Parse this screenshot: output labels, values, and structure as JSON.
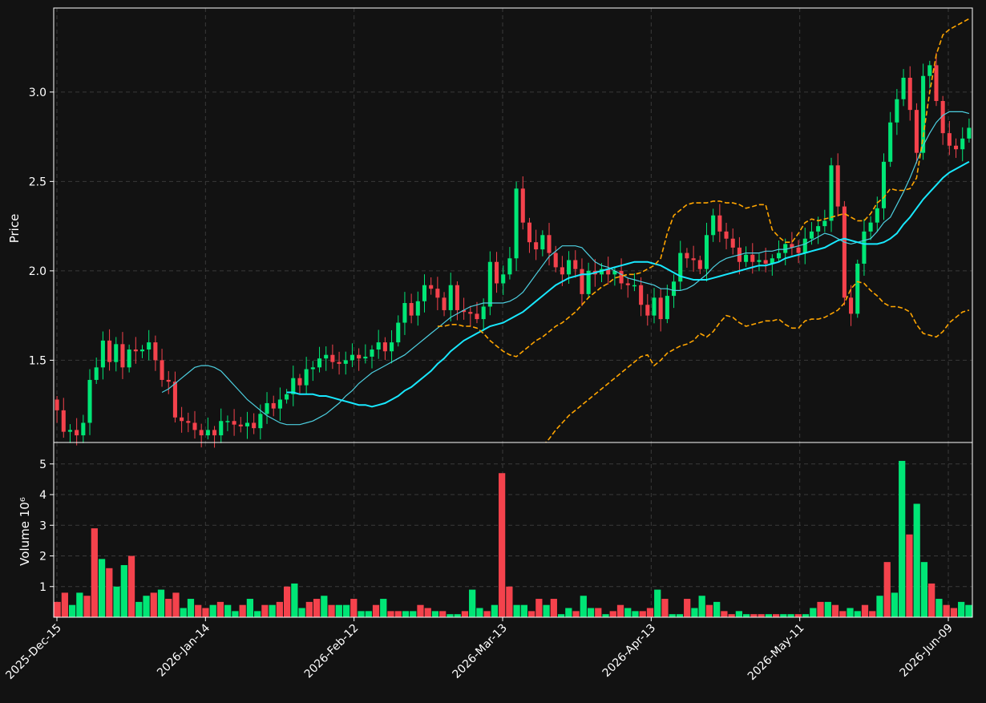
{
  "colors": {
    "background": "#121212",
    "axis": "#ffffff",
    "grid": "#3a3a3a",
    "up": "#00e676",
    "down": "#f4424c",
    "ma_fast": "#4dd0e1",
    "ma_slow": "#18e8ff",
    "bollinger": "#ffa500"
  },
  "chart_data": [
    {
      "type": "candlestick",
      "panel": "price",
      "ylabel": "Price",
      "ylim": [
        1.04,
        3.47
      ],
      "yticks": [
        "1.5",
        "2.0",
        "2.5",
        "3.0"
      ],
      "grid": true,
      "x_tick_labels": [
        "2025-Dec-15",
        "2026-Jan-14",
        "2026-Feb-12",
        "2026-Mar-13",
        "2026-Apr-13",
        "2026-May-11",
        "2026-Jun-09"
      ],
      "x_tick_positions": [
        0,
        26,
        52,
        78,
        104,
        130,
        156
      ],
      "series": [
        {
          "kind": "ohlc",
          "close": [
            1.22,
            1.1,
            1.11,
            1.08,
            1.15,
            1.39,
            1.46,
            1.61,
            1.49,
            1.59,
            1.46,
            1.56,
            1.55,
            1.56,
            1.6,
            1.5,
            1.39,
            1.38,
            1.18,
            1.16,
            1.15,
            1.11,
            1.08,
            1.11,
            1.08,
            1.16,
            1.16,
            1.14,
            1.13,
            1.15,
            1.12,
            1.2,
            1.26,
            1.23,
            1.28,
            1.31,
            1.4,
            1.36,
            1.45,
            1.46,
            1.51,
            1.53,
            1.49,
            1.48,
            1.5,
            1.53,
            1.51,
            1.52,
            1.56,
            1.6,
            1.55,
            1.6,
            1.71,
            1.82,
            1.75,
            1.83,
            1.92,
            1.9,
            1.85,
            1.78,
            1.92,
            1.78,
            1.77,
            1.76,
            1.73,
            1.8,
            2.05,
            1.93,
            1.98,
            2.07,
            2.46,
            2.27,
            2.16,
            2.12,
            2.2,
            2.1,
            2.02,
            1.98,
            2.06,
            2.01,
            1.87,
            2.0,
            1.98,
            2.01,
            1.98,
            2.0,
            1.93,
            1.92,
            1.92,
            1.81,
            1.75,
            1.85,
            1.73,
            1.86,
            1.94,
            2.1,
            2.07,
            2.06,
            2.01,
            2.2,
            2.31,
            2.22,
            2.18,
            2.13,
            2.05,
            2.09,
            2.05,
            2.06,
            2.04,
            2.07,
            2.1,
            2.15,
            2.13,
            2.1,
            2.18,
            2.22,
            2.25,
            2.28,
            2.59,
            2.36,
            1.85,
            1.76,
            2.04,
            2.22,
            2.27,
            2.35,
            2.61,
            2.83,
            2.96,
            3.08,
            2.9,
            2.66,
            3.09,
            3.15,
            2.95,
            2.77,
            2.7,
            2.68,
            2.74,
            2.8
          ]
        },
        {
          "kind": "moving_average",
          "name": "",
          "values": [
            1.32,
            1.34,
            1.37,
            1.4,
            1.43,
            1.46,
            1.47,
            1.47,
            1.46,
            1.44,
            1.4,
            1.36,
            1.32,
            1.28,
            1.25,
            1.22,
            1.19,
            1.17,
            1.15,
            1.14,
            1.14,
            1.14,
            1.15,
            1.16,
            1.18,
            1.2,
            1.23,
            1.26,
            1.3,
            1.33,
            1.37,
            1.4,
            1.43,
            1.45,
            1.47,
            1.49,
            1.51,
            1.53,
            1.56,
            1.59,
            1.62,
            1.65,
            1.68,
            1.71,
            1.74,
            1.76,
            1.78,
            1.8,
            1.81,
            1.82,
            1.82,
            1.82,
            1.82,
            1.83,
            1.85,
            1.88,
            1.93,
            1.98,
            2.03,
            2.08,
            2.11,
            2.14,
            2.14,
            2.14,
            2.13,
            2.09,
            2.05,
            2.03,
            2.02,
            2.0,
            1.98,
            1.96,
            1.95,
            1.94,
            1.93,
            1.92,
            1.9,
            1.9,
            1.89,
            1.89,
            1.9,
            1.92,
            1.95,
            1.98,
            2.02,
            2.05,
            2.07,
            2.08,
            2.09,
            2.1,
            2.1,
            2.1,
            2.11,
            2.11,
            2.12,
            2.12,
            2.13,
            2.14,
            2.15,
            2.17,
            2.19,
            2.21,
            2.2,
            2.18,
            2.16,
            2.15,
            2.16,
            2.17,
            2.18,
            2.22,
            2.27,
            2.3,
            2.37,
            2.44,
            2.52,
            2.61,
            2.7,
            2.77,
            2.83,
            2.87,
            2.89,
            2.89,
            2.89,
            2.88
          ]
        },
        {
          "kind": "moving_average",
          "name": "",
          "values": [
            1.32,
            1.32,
            1.31,
            1.31,
            1.31,
            1.3,
            1.3,
            1.29,
            1.28,
            1.27,
            1.26,
            1.25,
            1.25,
            1.24,
            1.25,
            1.26,
            1.28,
            1.3,
            1.33,
            1.35,
            1.38,
            1.41,
            1.44,
            1.48,
            1.51,
            1.55,
            1.58,
            1.61,
            1.63,
            1.65,
            1.67,
            1.69,
            1.7,
            1.71,
            1.73,
            1.75,
            1.77,
            1.8,
            1.83,
            1.86,
            1.89,
            1.92,
            1.94,
            1.96,
            1.97,
            1.98,
            1.98,
            1.99,
            2.0,
            2.01,
            2.02,
            2.03,
            2.04,
            2.05,
            2.05,
            2.05,
            2.04,
            2.03,
            2.01,
            1.99,
            1.97,
            1.96,
            1.95,
            1.95,
            1.95,
            1.96,
            1.97,
            1.98,
            1.99,
            2.0,
            2.01,
            2.02,
            2.03,
            2.03,
            2.04,
            2.05,
            2.07,
            2.08,
            2.09,
            2.1,
            2.11,
            2.12,
            2.13,
            2.15,
            2.17,
            2.18,
            2.17,
            2.16,
            2.15,
            2.15,
            2.15,
            2.16,
            2.18,
            2.21,
            2.26,
            2.3,
            2.35,
            2.4,
            2.44,
            2.48,
            2.52,
            2.55,
            2.57,
            2.59,
            2.61
          ]
        },
        {
          "kind": "bollinger_upper",
          "name": "",
          "values": [
            1.69,
            1.69,
            1.7,
            1.7,
            1.69,
            1.69,
            1.68,
            1.65,
            1.61,
            1.58,
            1.55,
            1.53,
            1.52,
            1.55,
            1.58,
            1.61,
            1.63,
            1.66,
            1.69,
            1.71,
            1.74,
            1.77,
            1.81,
            1.85,
            1.88,
            1.91,
            1.93,
            1.96,
            1.97,
            1.98,
            1.98,
            1.99,
            2.01,
            2.03,
            2.07,
            2.21,
            2.31,
            2.34,
            2.37,
            2.38,
            2.38,
            2.38,
            2.39,
            2.39,
            2.38,
            2.38,
            2.37,
            2.35,
            2.36,
            2.37,
            2.37,
            2.23,
            2.19,
            2.16,
            2.16,
            2.21,
            2.27,
            2.29,
            2.28,
            2.29,
            2.3,
            2.31,
            2.32,
            2.3,
            2.28,
            2.28,
            2.32,
            2.38,
            2.41,
            2.46,
            2.45,
            2.45,
            2.46,
            2.52,
            2.75,
            3.0,
            3.21,
            3.32,
            3.35,
            3.37,
            3.39,
            3.41
          ]
        },
        {
          "kind": "bollinger_lower",
          "name": "",
          "values": [
            0.93,
            0.97,
            1.02,
            1.06,
            1.11,
            1.15,
            1.19,
            1.22,
            1.25,
            1.28,
            1.31,
            1.34,
            1.37,
            1.4,
            1.43,
            1.46,
            1.49,
            1.52,
            1.53,
            1.47,
            1.5,
            1.54,
            1.56,
            1.58,
            1.59,
            1.61,
            1.65,
            1.63,
            1.66,
            1.71,
            1.75,
            1.74,
            1.71,
            1.69,
            1.7,
            1.71,
            1.72,
            1.72,
            1.73,
            1.7,
            1.68,
            1.68,
            1.72,
            1.73,
            1.73,
            1.74,
            1.76,
            1.78,
            1.82,
            1.9,
            1.94,
            1.93,
            1.89,
            1.86,
            1.82,
            1.8,
            1.8,
            1.79,
            1.77,
            1.7,
            1.65,
            1.64,
            1.63,
            1.66,
            1.71,
            1.74,
            1.77,
            1.78
          ]
        }
      ]
    },
    {
      "type": "bar",
      "panel": "volume",
      "ylabel": "Volume  10⁶",
      "ylim": [
        0,
        5.7
      ],
      "yticks": [
        "1",
        "2",
        "3",
        "4",
        "5"
      ],
      "grid": true,
      "values": [
        0.5,
        0.8,
        0.4,
        0.8,
        0.7,
        2.9,
        1.9,
        1.6,
        1.0,
        1.7,
        2.0,
        0.5,
        0.7,
        0.8,
        0.9,
        0.6,
        0.8,
        0.3,
        0.6,
        0.4,
        0.3,
        0.4,
        0.5,
        0.4,
        0.2,
        0.4,
        0.6,
        0.2,
        0.4,
        0.4,
        0.5,
        1.0,
        1.1,
        0.3,
        0.5,
        0.6,
        0.7,
        0.4,
        0.4,
        0.4,
        0.6,
        0.2,
        0.2,
        0.4,
        0.6,
        0.2,
        0.2,
        0.2,
        0.2,
        0.4,
        0.3,
        0.2,
        0.2,
        0.1,
        0.1,
        0.2,
        0.9,
        0.3,
        0.2,
        0.4,
        4.7,
        1.0,
        0.4,
        0.4,
        0.2,
        0.6,
        0.4,
        0.6,
        0.1,
        0.3,
        0.2,
        0.7,
        0.3,
        0.3,
        0.1,
        0.2,
        0.4,
        0.3,
        0.2,
        0.2,
        0.3,
        0.9,
        0.6,
        0.1,
        0.1,
        0.6,
        0.3,
        0.7,
        0.4,
        0.5,
        0.2,
        0.1,
        0.2,
        0.1,
        0.1,
        0.1,
        0.1,
        0.1,
        0.1,
        0.1,
        0.1,
        0.1,
        0.3,
        0.5,
        0.5,
        0.4,
        0.2,
        0.3,
        0.2,
        0.4,
        0.2,
        0.7,
        1.8,
        0.8,
        5.1,
        2.7,
        3.7,
        1.8,
        1.1,
        0.6,
        0.4,
        0.3,
        0.5,
        0.4
      ]
    }
  ]
}
